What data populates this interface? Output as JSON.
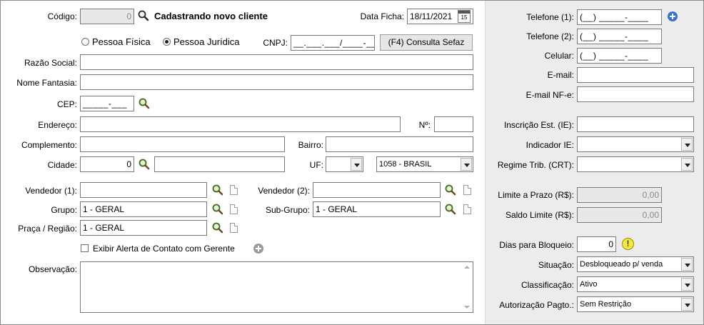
{
  "header": {
    "codigo_label": "Código:",
    "codigo_value": "0",
    "status_title": "Cadastrando novo cliente",
    "data_ficha_label": "Data Ficha:",
    "data_ficha_value": "18/11/2021",
    "calendar_day": "15"
  },
  "pessoa": {
    "fisica_label": "Pessoa Física",
    "juridica_label": "Pessoa Jurídica",
    "selected": "juridica"
  },
  "cnpj": {
    "label": "CNPJ:",
    "value": "__.___.___/____-__",
    "consulta_button": "(F4) Consulta Sefaz"
  },
  "razao_social": {
    "label": "Razão Social:",
    "value": ""
  },
  "nome_fantasia": {
    "label": "Nome Fantasia:",
    "value": ""
  },
  "cep": {
    "label": "CEP:",
    "value": "_____-___"
  },
  "endereco": {
    "label": "Endereço:",
    "value": "",
    "numero_label": "Nº:",
    "numero_value": ""
  },
  "complemento": {
    "label": "Complemento:",
    "value": "",
    "bairro_label": "Bairro:",
    "bairro_value": ""
  },
  "cidade": {
    "label": "Cidade:",
    "code": "0",
    "name": "",
    "uf_label": "UF:",
    "uf_value": "",
    "pais_value": "1058 - BRASIL"
  },
  "vendedor1": {
    "label": "Vendedor (1):",
    "value": ""
  },
  "vendedor2": {
    "label": "Vendedor (2):",
    "value": ""
  },
  "grupo": {
    "label": "Grupo:",
    "value": "1 - GERAL"
  },
  "subgrupo": {
    "label": "Sub-Grupo:",
    "value": "1 - GERAL"
  },
  "praca": {
    "label": "Praça / Região:",
    "value": "1 - GERAL"
  },
  "alerta": {
    "label": "Exibir Alerta de Contato com Gerente",
    "checked": false
  },
  "observacao": {
    "label": "Observação:",
    "value": ""
  },
  "right": {
    "telefone1_label": "Telefone (1):",
    "telefone1_value": "(__) _____-____",
    "telefone2_label": "Telefone (2):",
    "telefone2_value": "(__) _____-____",
    "celular_label": "Celular:",
    "celular_value": "(__) _____-____",
    "email_label": "E-mail:",
    "email_value": "",
    "email_nfe_label": "E-mail NF-e:",
    "email_nfe_value": "",
    "ie_label": "Inscrição Est. (IE):",
    "ie_value": "",
    "indicador_ie_label": "Indicador IE:",
    "indicador_ie_value": "",
    "regime_label": "Regime Trib. (CRT):",
    "regime_value": "",
    "limite_label": "Limite a Prazo (R$):",
    "limite_value": "0,00",
    "saldo_label": "Saldo Limite (R$):",
    "saldo_value": "0,00",
    "dias_label": "Dias para Bloqueio:",
    "dias_value": "0",
    "situacao_label": "Situação:",
    "situacao_value": "Desbloqueado p/ venda",
    "classificacao_label": "Classificação:",
    "classificacao_value": "Ativo",
    "autorizacao_label": "Autorização Pagto.:",
    "autorizacao_value": "Sem Restrição"
  },
  "colors": {
    "panel_bg": "#ececec",
    "disabled_bg": "#e8e8e8",
    "add_phone_icon": "#3a6fd8",
    "add_alert_icon": "#9a9a9a",
    "warning_icon": "#f2e93a"
  },
  "icons": {
    "search": "magnifier-icon",
    "lookup": "green-magnifier-icon",
    "document": "document-icon",
    "calendar": "calendar-icon",
    "add": "plus-circle-icon",
    "warning": "exclamation-icon"
  }
}
